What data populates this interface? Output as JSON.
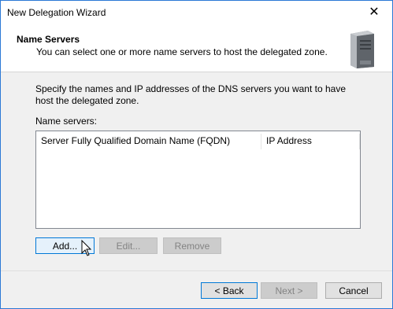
{
  "window": {
    "title": "New Delegation Wizard",
    "close_glyph": "✕"
  },
  "header": {
    "title": "Name Servers",
    "subtitle": "You can select one or more name servers to host the delegated zone."
  },
  "body": {
    "intro": "Specify the names and IP addresses of the DNS servers you want to have host the delegated zone.",
    "ns_label": "Name servers:",
    "columns": [
      "Server Fully Qualified Domain Name (FQDN)",
      "IP Address"
    ]
  },
  "buttons": {
    "add": "Add...",
    "edit": "Edit...",
    "remove": "Remove",
    "back": "< Back",
    "next": "Next >",
    "cancel": "Cancel"
  },
  "colors": {
    "accent": "#0078d7",
    "border": "#2b79d6",
    "dialog_bg": "#f0f0f0"
  }
}
